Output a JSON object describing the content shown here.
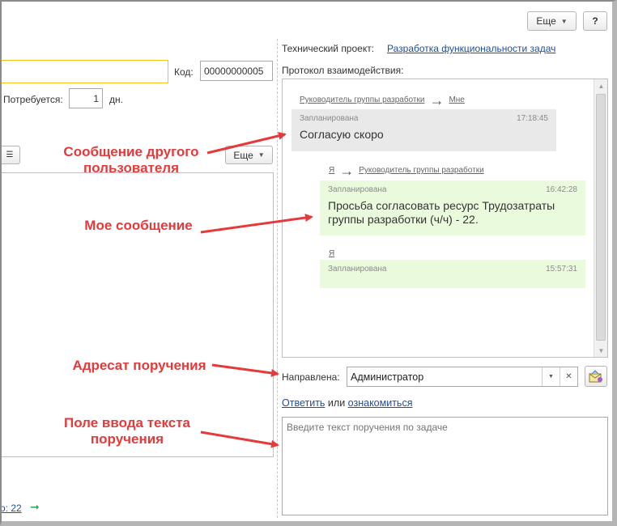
{
  "toolbar": {
    "more_label": "Еще",
    "help_label": "?"
  },
  "left_form": {
    "code_label": "Код:",
    "code_value": "00000000005",
    "duration_label": "Потребуется:",
    "duration_value": "1",
    "duration_unit": "дн.",
    "list_more_label": "Еще",
    "bottom_link": "о: 22"
  },
  "right_panel": {
    "project_label": "Технический проект:",
    "project_link": "Разработка функциональности задач",
    "protocol_label": "Протокол взаимодействия:"
  },
  "messages": [
    {
      "from": "Руководитель группы разработки",
      "to": "Мне",
      "status": "Запланирована",
      "time": "17:18:45",
      "text": "Согласую скоро"
    },
    {
      "from": "Я",
      "to": "Руководитель группы разработки",
      "status": "Запланирована",
      "time": "16:42:28",
      "text": "Просьба согласовать ресурс Трудозатраты группы разработки (ч/ч) - 22."
    },
    {
      "from": "Я",
      "to": "",
      "status": "Запланирована",
      "time": "15:57:31",
      "text": ""
    }
  ],
  "recipient": {
    "label": "Направлена:",
    "value": "Администратор"
  },
  "reply": {
    "reply_link": "Ответить",
    "or_text": "или",
    "ack_link": "ознакомиться"
  },
  "message_input": {
    "placeholder": "Введите текст поручения по задаче"
  },
  "annotations": {
    "other_user": "Сообщение другого пользователя",
    "my_message": "Мое сообщение",
    "recipient": "Адресат поручения",
    "input_field": "Поле ввода текста поручения"
  },
  "colors": {
    "accent_link": "#1f4e9c",
    "annotation_red": "#e8393a",
    "focused_border": "#f0c419",
    "other_bubble": "#e9e9e9",
    "my_bubble": "#eafbdd"
  }
}
